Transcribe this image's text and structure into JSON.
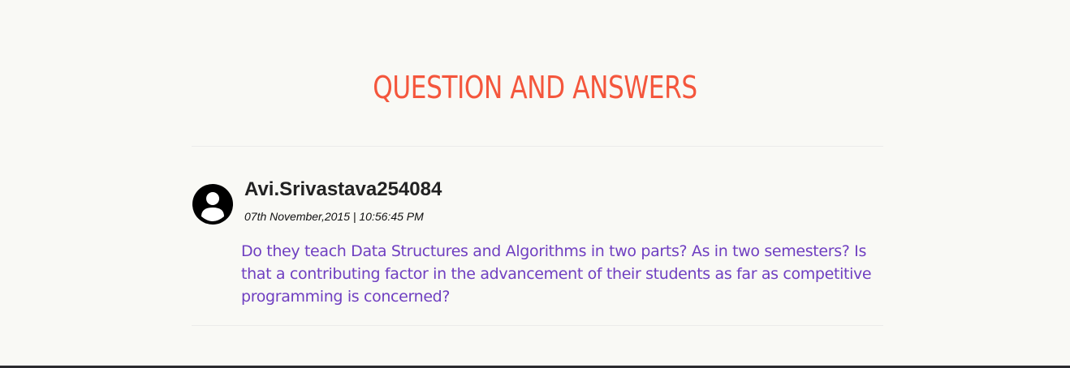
{
  "section": {
    "title": "QUESTION AND ANSWERS"
  },
  "questions": [
    {
      "author": "Avi.Srivastava254084",
      "timestamp": "07th November,2015 | 10:56:45 PM",
      "text": "Do they teach Data Structures and Algorithms in two parts? As in two semesters? Is that a contributing factor in the advancement of their students as far as competitive programming is concerned?",
      "avatar_icon": "user-circle-icon"
    }
  ],
  "colors": {
    "background": "#f9f9f5",
    "title": "#f4563c",
    "question_text": "#6f3fc1",
    "author_text": "#222222",
    "footer_bar": "#2b2b2f"
  }
}
